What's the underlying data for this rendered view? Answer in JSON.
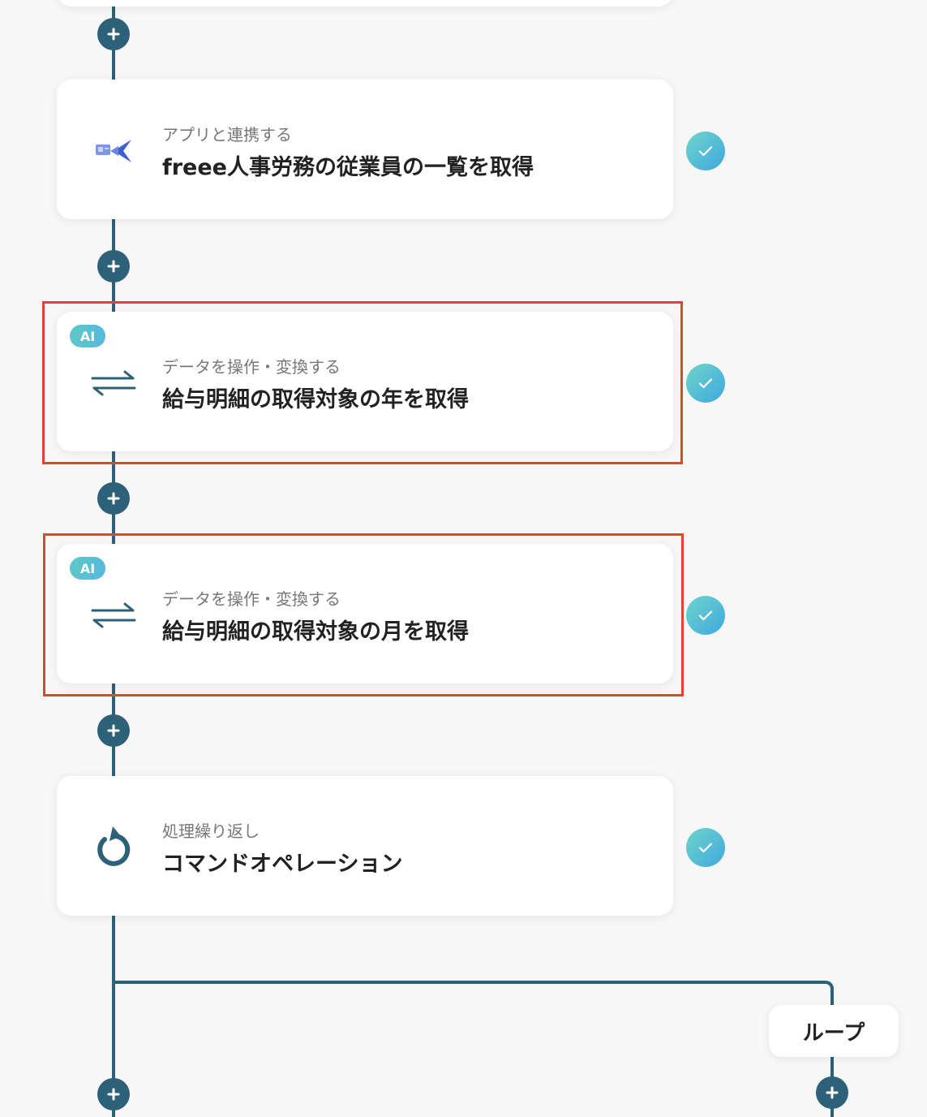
{
  "steps": [
    {
      "sub": "アプリと連携する",
      "title": "freee人事労務の従業員の一覧を取得",
      "icon": "freee-hr-app-icon",
      "ai": false
    },
    {
      "sub": "データを操作・変換する",
      "title": "給与明細の取得対象の年を取得",
      "icon": "convert-arrows-icon",
      "ai": true,
      "ai_label": "AI"
    },
    {
      "sub": "データを操作・変換する",
      "title": "給与明細の取得対象の月を取得",
      "icon": "convert-arrows-icon",
      "ai": true,
      "ai_label": "AI"
    },
    {
      "sub": "処理繰り返し",
      "title": "コマンドオペレーション",
      "icon": "loop-repeat-icon",
      "ai": false
    }
  ],
  "loop_label": "ループ",
  "colors": {
    "line": "#2d6079",
    "highlight": "#e34432",
    "check_gradient": [
      "#6fd5c8",
      "#3fa8e0"
    ],
    "ai_badge": [
      "#5fc8c8",
      "#57b8dc"
    ]
  }
}
